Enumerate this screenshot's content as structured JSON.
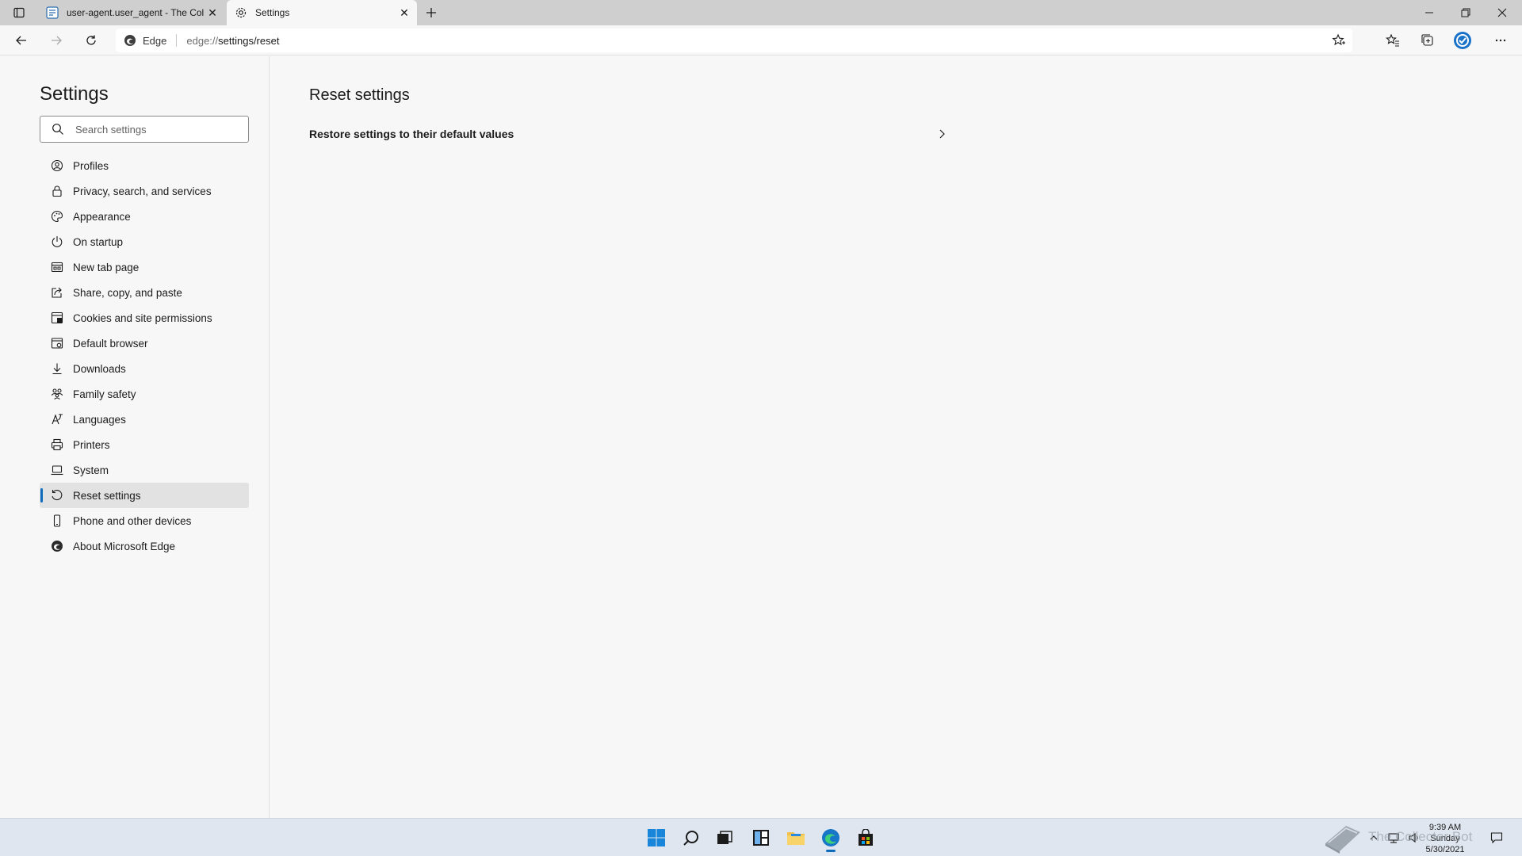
{
  "browser": {
    "tabs": [
      {
        "title": "user-agent.user_agent - The Coll",
        "active": false
      },
      {
        "title": "Settings",
        "active": true
      }
    ],
    "site_chip": "Edge",
    "url_host": "edge://",
    "url_path": "settings/reset"
  },
  "sidebar": {
    "title": "Settings",
    "search_placeholder": "Search settings",
    "items": [
      {
        "label": "Profiles",
        "icon": "profile-icon"
      },
      {
        "label": "Privacy, search, and services",
        "icon": "lock-icon"
      },
      {
        "label": "Appearance",
        "icon": "palette-icon"
      },
      {
        "label": "On startup",
        "icon": "power-icon"
      },
      {
        "label": "New tab page",
        "icon": "new-tab-icon"
      },
      {
        "label": "Share, copy, and paste",
        "icon": "share-icon"
      },
      {
        "label": "Cookies and site permissions",
        "icon": "cookies-icon"
      },
      {
        "label": "Default browser",
        "icon": "browser-icon"
      },
      {
        "label": "Downloads",
        "icon": "download-icon"
      },
      {
        "label": "Family safety",
        "icon": "family-icon"
      },
      {
        "label": "Languages",
        "icon": "languages-icon"
      },
      {
        "label": "Printers",
        "icon": "printer-icon"
      },
      {
        "label": "System",
        "icon": "laptop-icon"
      },
      {
        "label": "Reset settings",
        "icon": "reset-icon",
        "selected": true
      },
      {
        "label": "Phone and other devices",
        "icon": "phone-icon"
      },
      {
        "label": "About Microsoft Edge",
        "icon": "edge-icon"
      }
    ]
  },
  "main": {
    "title": "Reset settings",
    "restore_label": "Restore settings to their default values"
  },
  "taskbar": {
    "time": "9:39 AM",
    "day": "Sunday",
    "date": "5/30/2021",
    "watermark": "The Collector Bot"
  },
  "colors": {
    "accent": "#0f6cbd",
    "background": "#f7f7f7",
    "tabbar": "#cfcfcf",
    "taskbar": "#dfe6ef"
  }
}
